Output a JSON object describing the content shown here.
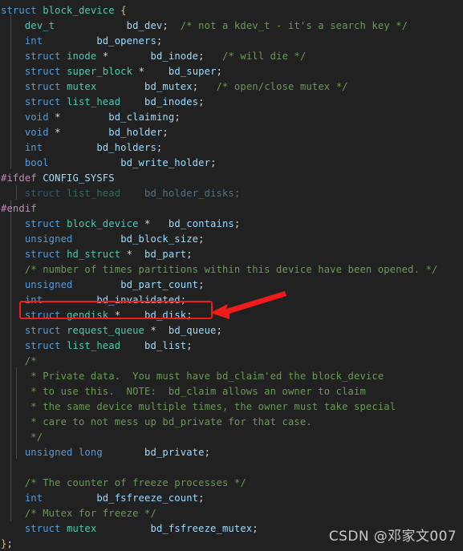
{
  "document": {
    "kind": "source-code-view",
    "language": "C",
    "background_color": "#212121",
    "colors": {
      "keyword": "#569cd6",
      "type": "#4ec9b0",
      "identifier": "#9cdcfe",
      "comment": "#6a9955",
      "preprocessor": "#c586c0",
      "punctuation": "#d4d4d4",
      "brace": "#d7ba7d",
      "annotation_red": "#f01b1b",
      "watermark": "#c9c9c9"
    }
  },
  "code": {
    "lines": [
      {
        "n": 1,
        "tokens": [
          {
            "t": "kw",
            "v": "struct"
          },
          {
            "t": "punc",
            "v": " "
          },
          {
            "t": "type",
            "v": "block_device"
          },
          {
            "t": "punc",
            "v": " "
          },
          {
            "t": "brace",
            "v": "{"
          }
        ]
      },
      {
        "n": 2,
        "tokens": [
          {
            "t": "punc",
            "v": "    "
          },
          {
            "t": "type",
            "v": "dev_t"
          },
          {
            "t": "punc",
            "v": "            "
          },
          {
            "t": "id",
            "v": "bd_dev"
          },
          {
            "t": "punc",
            "v": ";"
          },
          {
            "t": "punc",
            "v": "  "
          },
          {
            "t": "cmt",
            "v": "/* not a kdev_t - it's a search key */"
          }
        ]
      },
      {
        "n": 3,
        "tokens": [
          {
            "t": "punc",
            "v": "    "
          },
          {
            "t": "kw",
            "v": "int"
          },
          {
            "t": "punc",
            "v": "         "
          },
          {
            "t": "id",
            "v": "bd_openers"
          },
          {
            "t": "punc",
            "v": ";"
          }
        ]
      },
      {
        "n": 4,
        "tokens": [
          {
            "t": "punc",
            "v": "    "
          },
          {
            "t": "kw",
            "v": "struct"
          },
          {
            "t": "punc",
            "v": " "
          },
          {
            "t": "type",
            "v": "inode"
          },
          {
            "t": "punc",
            "v": " *"
          },
          {
            "t": "punc",
            "v": "       "
          },
          {
            "t": "id",
            "v": "bd_inode"
          },
          {
            "t": "punc",
            "v": ";"
          },
          {
            "t": "punc",
            "v": "   "
          },
          {
            "t": "cmt",
            "v": "/* will die */"
          }
        ]
      },
      {
        "n": 5,
        "tokens": [
          {
            "t": "punc",
            "v": "    "
          },
          {
            "t": "kw",
            "v": "struct"
          },
          {
            "t": "punc",
            "v": " "
          },
          {
            "t": "type",
            "v": "super_block"
          },
          {
            "t": "punc",
            "v": " *"
          },
          {
            "t": "punc",
            "v": "    "
          },
          {
            "t": "id",
            "v": "bd_super"
          },
          {
            "t": "punc",
            "v": ";"
          }
        ]
      },
      {
        "n": 6,
        "tokens": [
          {
            "t": "punc",
            "v": "    "
          },
          {
            "t": "kw",
            "v": "struct"
          },
          {
            "t": "punc",
            "v": " "
          },
          {
            "t": "type",
            "v": "mutex"
          },
          {
            "t": "punc",
            "v": "        "
          },
          {
            "t": "id",
            "v": "bd_mutex"
          },
          {
            "t": "punc",
            "v": ";"
          },
          {
            "t": "punc",
            "v": "   "
          },
          {
            "t": "cmt",
            "v": "/* open/close mutex */"
          }
        ]
      },
      {
        "n": 7,
        "tokens": [
          {
            "t": "punc",
            "v": "    "
          },
          {
            "t": "kw",
            "v": "struct"
          },
          {
            "t": "punc",
            "v": " "
          },
          {
            "t": "type",
            "v": "list_head"
          },
          {
            "t": "punc",
            "v": "    "
          },
          {
            "t": "id",
            "v": "bd_inodes"
          },
          {
            "t": "punc",
            "v": ";"
          }
        ]
      },
      {
        "n": 8,
        "tokens": [
          {
            "t": "punc",
            "v": "    "
          },
          {
            "t": "kw",
            "v": "void"
          },
          {
            "t": "punc",
            "v": " *"
          },
          {
            "t": "punc",
            "v": "        "
          },
          {
            "t": "id",
            "v": "bd_claiming"
          },
          {
            "t": "punc",
            "v": ";"
          }
        ]
      },
      {
        "n": 9,
        "tokens": [
          {
            "t": "punc",
            "v": "    "
          },
          {
            "t": "kw",
            "v": "void"
          },
          {
            "t": "punc",
            "v": " *"
          },
          {
            "t": "punc",
            "v": "        "
          },
          {
            "t": "id",
            "v": "bd_holder"
          },
          {
            "t": "punc",
            "v": ";"
          }
        ]
      },
      {
        "n": 10,
        "tokens": [
          {
            "t": "punc",
            "v": "    "
          },
          {
            "t": "kw",
            "v": "int"
          },
          {
            "t": "punc",
            "v": "         "
          },
          {
            "t": "id",
            "v": "bd_holders"
          },
          {
            "t": "punc",
            "v": ";"
          }
        ]
      },
      {
        "n": 11,
        "tokens": [
          {
            "t": "punc",
            "v": "    "
          },
          {
            "t": "kw",
            "v": "bool"
          },
          {
            "t": "punc",
            "v": "            "
          },
          {
            "t": "id",
            "v": "bd_write_holder"
          },
          {
            "t": "punc",
            "v": ";"
          }
        ]
      },
      {
        "n": 12,
        "tokens": [
          {
            "t": "pp",
            "v": "#ifdef"
          },
          {
            "t": "punc",
            "v": " "
          },
          {
            "t": "ppid",
            "v": "CONFIG_SYSFS"
          }
        ]
      },
      {
        "n": 13,
        "dim": true,
        "tokens": [
          {
            "t": "punc",
            "v": "    "
          },
          {
            "t": "kw",
            "v": "struct"
          },
          {
            "t": "punc",
            "v": " "
          },
          {
            "t": "type",
            "v": "list_head"
          },
          {
            "t": "punc",
            "v": "    "
          },
          {
            "t": "id",
            "v": "bd_holder_disks"
          },
          {
            "t": "punc",
            "v": ";"
          }
        ]
      },
      {
        "n": 14,
        "tokens": [
          {
            "t": "pp",
            "v": "#endif"
          }
        ]
      },
      {
        "n": 15,
        "tokens": [
          {
            "t": "punc",
            "v": "    "
          },
          {
            "t": "kw",
            "v": "struct"
          },
          {
            "t": "punc",
            "v": " "
          },
          {
            "t": "type",
            "v": "block_device"
          },
          {
            "t": "punc",
            "v": " *"
          },
          {
            "t": "punc",
            "v": "   "
          },
          {
            "t": "id",
            "v": "bd_contains"
          },
          {
            "t": "punc",
            "v": ";"
          }
        ]
      },
      {
        "n": 16,
        "tokens": [
          {
            "t": "punc",
            "v": "    "
          },
          {
            "t": "kw",
            "v": "unsigned"
          },
          {
            "t": "punc",
            "v": "        "
          },
          {
            "t": "id",
            "v": "bd_block_size"
          },
          {
            "t": "punc",
            "v": ";"
          }
        ]
      },
      {
        "n": 17,
        "tokens": [
          {
            "t": "punc",
            "v": "    "
          },
          {
            "t": "kw",
            "v": "struct"
          },
          {
            "t": "punc",
            "v": " "
          },
          {
            "t": "type",
            "v": "hd_struct"
          },
          {
            "t": "punc",
            "v": " *"
          },
          {
            "t": "punc",
            "v": "  "
          },
          {
            "t": "id",
            "v": "bd_part"
          },
          {
            "t": "punc",
            "v": ";"
          }
        ]
      },
      {
        "n": 18,
        "tokens": [
          {
            "t": "punc",
            "v": "    "
          },
          {
            "t": "cmt",
            "v": "/* number of times partitions within this device have been opened. */"
          }
        ]
      },
      {
        "n": 19,
        "tokens": [
          {
            "t": "punc",
            "v": "    "
          },
          {
            "t": "kw",
            "v": "unsigned"
          },
          {
            "t": "punc",
            "v": "        "
          },
          {
            "t": "id",
            "v": "bd_part_count"
          },
          {
            "t": "punc",
            "v": ";"
          }
        ]
      },
      {
        "n": 20,
        "tokens": [
          {
            "t": "punc",
            "v": "    "
          },
          {
            "t": "kw",
            "v": "int"
          },
          {
            "t": "punc",
            "v": "         "
          },
          {
            "t": "id",
            "v": "bd_invalidated"
          },
          {
            "t": "punc",
            "v": ";"
          }
        ]
      },
      {
        "n": 21,
        "highlighted": true,
        "tokens": [
          {
            "t": "punc",
            "v": "    "
          },
          {
            "t": "kw",
            "v": "struct"
          },
          {
            "t": "punc",
            "v": " "
          },
          {
            "t": "type",
            "v": "gendisk"
          },
          {
            "t": "punc",
            "v": " *"
          },
          {
            "t": "punc",
            "v": "    "
          },
          {
            "t": "id",
            "v": "bd_disk"
          },
          {
            "t": "punc",
            "v": ";"
          }
        ]
      },
      {
        "n": 22,
        "tokens": [
          {
            "t": "punc",
            "v": "    "
          },
          {
            "t": "kw",
            "v": "struct"
          },
          {
            "t": "punc",
            "v": " "
          },
          {
            "t": "type",
            "v": "request_queue"
          },
          {
            "t": "punc",
            "v": " *"
          },
          {
            "t": "punc",
            "v": "  "
          },
          {
            "t": "id",
            "v": "bd_queue"
          },
          {
            "t": "punc",
            "v": ";"
          }
        ]
      },
      {
        "n": 23,
        "tokens": [
          {
            "t": "punc",
            "v": "    "
          },
          {
            "t": "kw",
            "v": "struct"
          },
          {
            "t": "punc",
            "v": " "
          },
          {
            "t": "type",
            "v": "list_head"
          },
          {
            "t": "punc",
            "v": "    "
          },
          {
            "t": "id",
            "v": "bd_list"
          },
          {
            "t": "punc",
            "v": ";"
          }
        ]
      },
      {
        "n": 24,
        "tokens": [
          {
            "t": "punc",
            "v": "    "
          },
          {
            "t": "cmt",
            "v": "/*"
          }
        ]
      },
      {
        "n": 25,
        "tokens": [
          {
            "t": "punc",
            "v": "    "
          },
          {
            "t": "cmt",
            "v": " * Private data.  You must have bd_claim'ed the block_device"
          }
        ]
      },
      {
        "n": 26,
        "tokens": [
          {
            "t": "punc",
            "v": "    "
          },
          {
            "t": "cmt",
            "v": " * to use this.  NOTE:  bd_claim allows an owner to claim"
          }
        ]
      },
      {
        "n": 27,
        "tokens": [
          {
            "t": "punc",
            "v": "    "
          },
          {
            "t": "cmt",
            "v": " * the same device multiple times, the owner must take special"
          }
        ]
      },
      {
        "n": 28,
        "tokens": [
          {
            "t": "punc",
            "v": "    "
          },
          {
            "t": "cmt",
            "v": " * care to not mess up bd_private for that case."
          }
        ]
      },
      {
        "n": 29,
        "tokens": [
          {
            "t": "punc",
            "v": "    "
          },
          {
            "t": "cmt",
            "v": " */"
          }
        ]
      },
      {
        "n": 30,
        "tokens": [
          {
            "t": "punc",
            "v": "    "
          },
          {
            "t": "kw",
            "v": "unsigned long"
          },
          {
            "t": "punc",
            "v": "       "
          },
          {
            "t": "id",
            "v": "bd_private"
          },
          {
            "t": "punc",
            "v": ";"
          }
        ]
      },
      {
        "n": 31,
        "tokens": []
      },
      {
        "n": 32,
        "tokens": [
          {
            "t": "punc",
            "v": "    "
          },
          {
            "t": "cmt",
            "v": "/* The counter of freeze processes */"
          }
        ]
      },
      {
        "n": 33,
        "tokens": [
          {
            "t": "punc",
            "v": "    "
          },
          {
            "t": "kw",
            "v": "int"
          },
          {
            "t": "punc",
            "v": "         "
          },
          {
            "t": "id",
            "v": "bd_fsfreeze_count"
          },
          {
            "t": "punc",
            "v": ";"
          }
        ]
      },
      {
        "n": 34,
        "tokens": [
          {
            "t": "punc",
            "v": "    "
          },
          {
            "t": "cmt",
            "v": "/* Mutex for freeze */"
          }
        ]
      },
      {
        "n": 35,
        "tokens": [
          {
            "t": "punc",
            "v": "    "
          },
          {
            "t": "kw",
            "v": "struct"
          },
          {
            "t": "punc",
            "v": " "
          },
          {
            "t": "type",
            "v": "mutex"
          },
          {
            "t": "punc",
            "v": "         "
          },
          {
            "t": "id",
            "v": "bd_fsfreeze_mutex"
          },
          {
            "t": "punc",
            "v": ";"
          }
        ]
      },
      {
        "n": 36,
        "tokens": [
          {
            "t": "brace",
            "v": "}"
          },
          {
            "t": "punc",
            "v": ";"
          }
        ]
      }
    ]
  },
  "annotation": {
    "highlight_target": "struct gendisk *    bd_disk;",
    "highlight_color": "#f01b1b",
    "arrow_color": "#f01b1b",
    "arrow_direction": "points-left-to-highlight-box"
  },
  "watermark": {
    "text": "CSDN @邓家文007"
  }
}
